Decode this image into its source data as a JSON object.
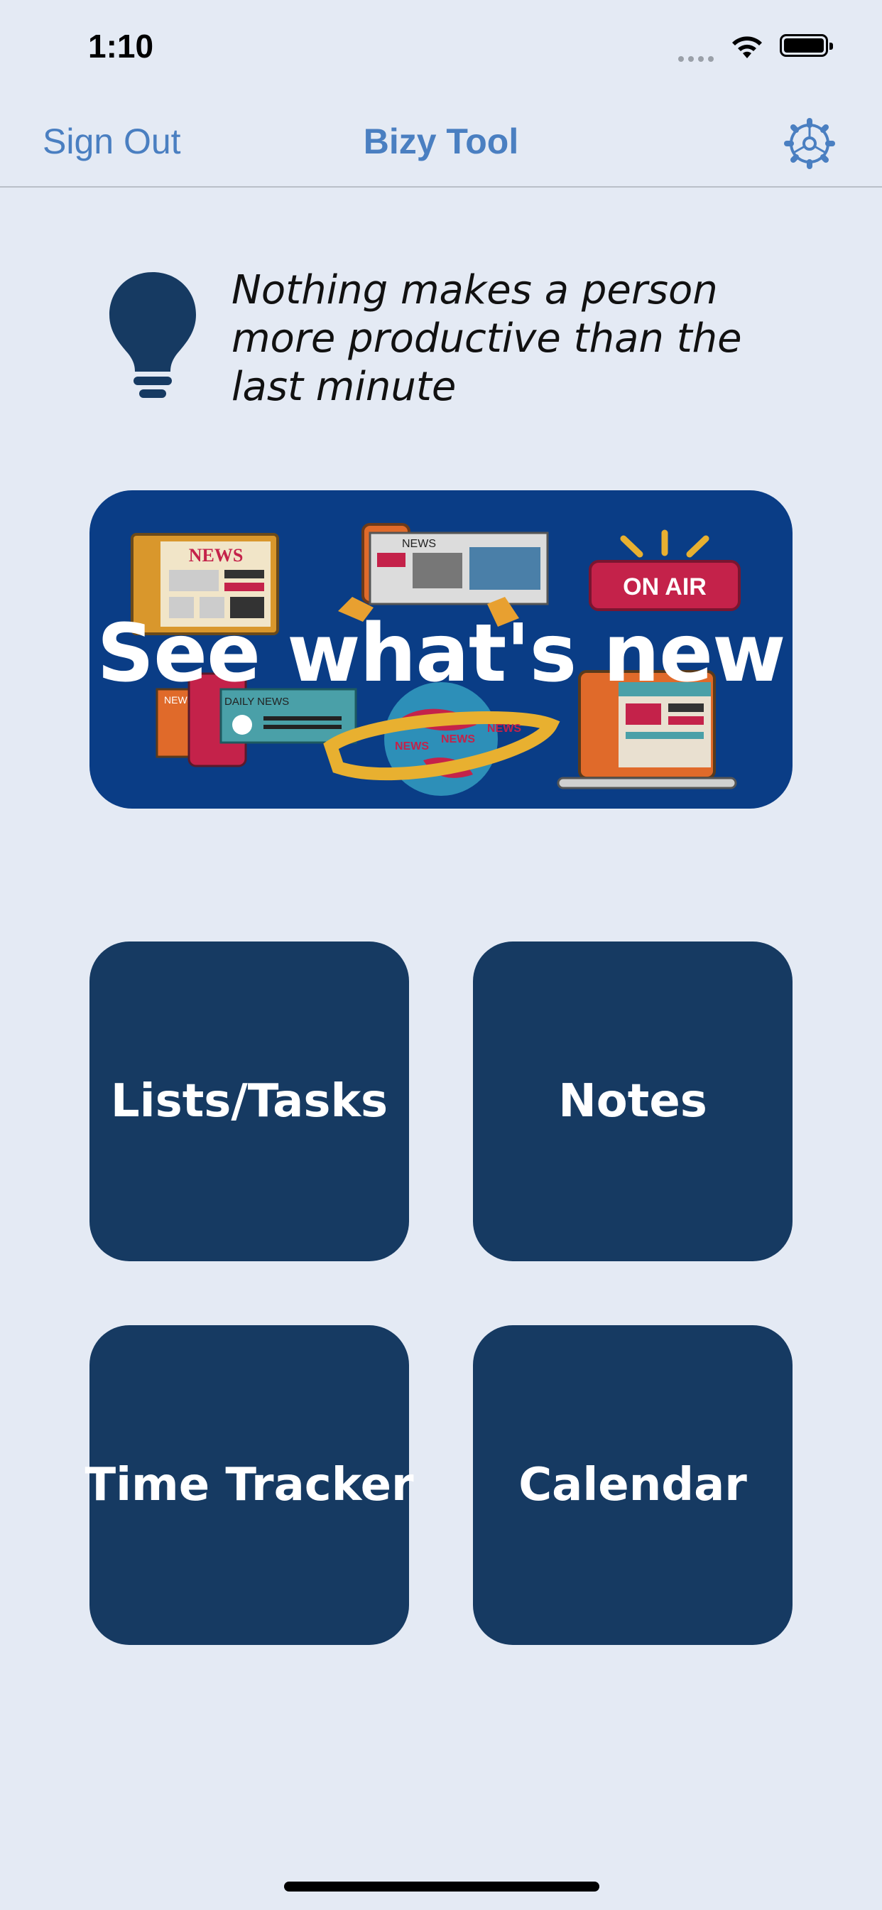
{
  "status_bar": {
    "time": "1:10",
    "icons": [
      "signal-icon",
      "wifi-icon",
      "battery-icon"
    ]
  },
  "nav": {
    "left_action": "Sign Out",
    "title": "Bizy Tool",
    "right_icon": "gear-icon"
  },
  "quote": {
    "icon": "lightbulb-icon",
    "text": "Nothing makes a person more productive than the last minute"
  },
  "banner": {
    "title": "See what's new",
    "image_texts": [
      "NEWS",
      "NEWS",
      "ON AIR",
      "NEWS",
      "DAILY NEWS",
      "NEWS",
      "NEWS",
      "NEWS"
    ]
  },
  "tiles": [
    {
      "label": "Lists/Tasks"
    },
    {
      "label": "Notes"
    },
    {
      "label": "Time Tracker"
    },
    {
      "label": "Calendar"
    }
  ],
  "colors": {
    "background": "#e4eaf4",
    "accent": "#4a7fc1",
    "tile": "#163a62",
    "banner": "#0a3d86"
  }
}
